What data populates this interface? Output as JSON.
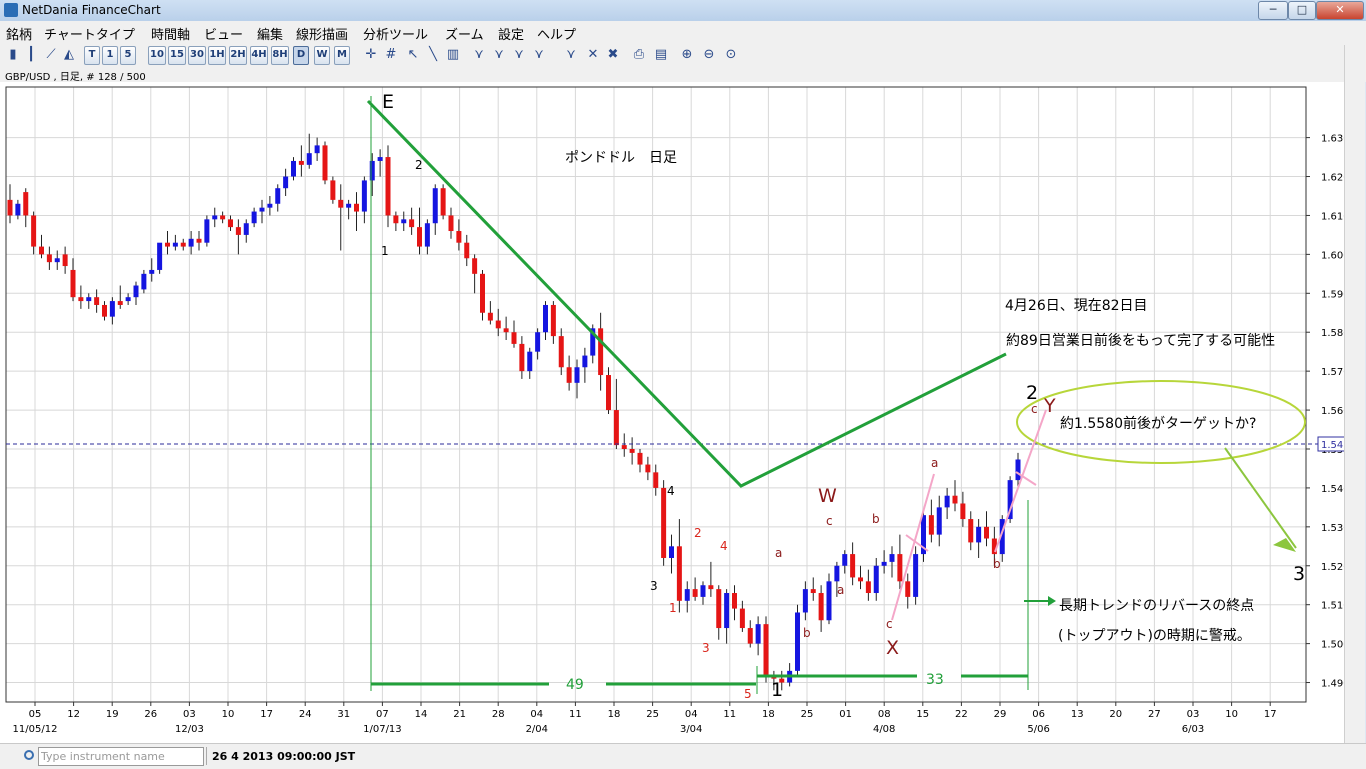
{
  "window": {
    "title": "NetDania FinanceChart",
    "min": "─",
    "max": "□",
    "close": "✕"
  },
  "menu": [
    "銘柄",
    "チャートタイプ",
    "時間軸",
    "ビュー",
    "編集",
    "線形描画",
    "分析ツール",
    "ズーム",
    "設定",
    "ヘルプ"
  ],
  "toolbar": {
    "timeframes": [
      "T",
      "1",
      "5",
      "10",
      "15",
      "30",
      "1H",
      "2H",
      "4H",
      "8H",
      "D",
      "W",
      "M"
    ],
    "selected": "D"
  },
  "info": "GBP/USD , 日足, # 128 / 500",
  "search": {
    "placeholder": "Type instrument name"
  },
  "status": {
    "datetime": "26 4 2013 09:00:00 JST"
  },
  "chart_data": {
    "type": "candlestick",
    "symbol": "GBP/USD",
    "timeframe": "日足",
    "ylim": [
      1.485,
      1.643
    ],
    "y_ticks": [
      "1.6300",
      "1.6200",
      "1.6100",
      "1.6000",
      "1.5900",
      "1.5800",
      "1.5700",
      "1.5600",
      "1.5500",
      "1.5400",
      "1.5300",
      "1.5200",
      "1.5100",
      "1.5000",
      "1.4900"
    ],
    "current_price": "1.5473",
    "x_ticks": [
      "05",
      "12",
      "19",
      "26",
      "03",
      "10",
      "17",
      "24",
      "31",
      "07",
      "14",
      "21",
      "28",
      "04",
      "11",
      "18",
      "25",
      "04",
      "11",
      "18",
      "25",
      "01",
      "08",
      "15",
      "22",
      "29",
      "06",
      "13",
      "20",
      "27",
      "03",
      "10",
      "17"
    ],
    "x_month_labels": [
      "11/05/12",
      "12/03",
      "1/07/13",
      "2/04",
      "3/04",
      "4/08",
      "5/06",
      "6/03"
    ],
    "up_color": "#1515e0",
    "down_color": "#e51515",
    "candles": [
      [
        1.614,
        1.618,
        1.608,
        1.61
      ],
      [
        1.61,
        1.614,
        1.609,
        1.613
      ],
      [
        1.616,
        1.617,
        1.607,
        1.61
      ],
      [
        1.61,
        1.611,
        1.6,
        1.602
      ],
      [
        1.602,
        1.605,
        1.599,
        1.6
      ],
      [
        1.6,
        1.602,
        1.596,
        1.598
      ],
      [
        1.598,
        1.601,
        1.596,
        1.599
      ],
      [
        1.6,
        1.602,
        1.595,
        1.597
      ],
      [
        1.596,
        1.599,
        1.588,
        1.589
      ],
      [
        1.589,
        1.592,
        1.586,
        1.588
      ],
      [
        1.588,
        1.59,
        1.586,
        1.589
      ],
      [
        1.589,
        1.591,
        1.585,
        1.587
      ],
      [
        1.587,
        1.588,
        1.583,
        1.584
      ],
      [
        1.584,
        1.589,
        1.582,
        1.588
      ],
      [
        1.588,
        1.592,
        1.586,
        1.587
      ],
      [
        1.588,
        1.59,
        1.587,
        1.589
      ],
      [
        1.589,
        1.593,
        1.587,
        1.592
      ],
      [
        1.591,
        1.596,
        1.59,
        1.595
      ],
      [
        1.595,
        1.599,
        1.593,
        1.596
      ],
      [
        1.596,
        1.602,
        1.595,
        1.603
      ],
      [
        1.603,
        1.606,
        1.6,
        1.602
      ],
      [
        1.602,
        1.605,
        1.601,
        1.603
      ],
      [
        1.603,
        1.604,
        1.601,
        1.602
      ],
      [
        1.602,
        1.606,
        1.6,
        1.604
      ],
      [
        1.604,
        1.606,
        1.601,
        1.603
      ],
      [
        1.603,
        1.61,
        1.602,
        1.609
      ],
      [
        1.609,
        1.612,
        1.607,
        1.61
      ],
      [
        1.61,
        1.611,
        1.608,
        1.609
      ],
      [
        1.609,
        1.61,
        1.606,
        1.607
      ],
      [
        1.607,
        1.609,
        1.6,
        1.605
      ],
      [
        1.605,
        1.609,
        1.603,
        1.608
      ],
      [
        1.608,
        1.612,
        1.607,
        1.611
      ],
      [
        1.611,
        1.614,
        1.608,
        1.612
      ],
      [
        1.612,
        1.615,
        1.61,
        1.613
      ],
      [
        1.613,
        1.618,
        1.611,
        1.617
      ],
      [
        1.617,
        1.622,
        1.615,
        1.62
      ],
      [
        1.62,
        1.625,
        1.619,
        1.624
      ],
      [
        1.624,
        1.628,
        1.62,
        1.623
      ],
      [
        1.623,
        1.631,
        1.622,
        1.626
      ],
      [
        1.626,
        1.63,
        1.624,
        1.628
      ],
      [
        1.628,
        1.629,
        1.618,
        1.619
      ],
      [
        1.619,
        1.62,
        1.613,
        1.614
      ],
      [
        1.614,
        1.618,
        1.601,
        1.612
      ],
      [
        1.612,
        1.614,
        1.609,
        1.613
      ],
      [
        1.613,
        1.616,
        1.606,
        1.611
      ],
      [
        1.611,
        1.62,
        1.608,
        1.619
      ],
      [
        1.619,
        1.626,
        1.615,
        1.624
      ],
      [
        1.624,
        1.627,
        1.62,
        1.625
      ],
      [
        1.625,
        1.628,
        1.607,
        1.61
      ],
      [
        1.61,
        1.611,
        1.606,
        1.608
      ],
      [
        1.608,
        1.611,
        1.606,
        1.609
      ],
      [
        1.609,
        1.612,
        1.605,
        1.607
      ],
      [
        1.607,
        1.612,
        1.6,
        1.602
      ],
      [
        1.602,
        1.609,
        1.6,
        1.608
      ],
      [
        1.608,
        1.618,
        1.605,
        1.617
      ],
      [
        1.617,
        1.618,
        1.609,
        1.61
      ],
      [
        1.61,
        1.612,
        1.604,
        1.606
      ],
      [
        1.606,
        1.609,
        1.601,
        1.603
      ],
      [
        1.603,
        1.605,
        1.597,
        1.599
      ],
      [
        1.599,
        1.6,
        1.59,
        1.595
      ],
      [
        1.595,
        1.596,
        1.583,
        1.585
      ],
      [
        1.585,
        1.588,
        1.582,
        1.583
      ],
      [
        1.583,
        1.586,
        1.579,
        1.581
      ],
      [
        1.581,
        1.584,
        1.578,
        1.58
      ],
      [
        1.58,
        1.583,
        1.576,
        1.577
      ],
      [
        1.577,
        1.579,
        1.568,
        1.57
      ],
      [
        1.57,
        1.576,
        1.568,
        1.575
      ],
      [
        1.575,
        1.581,
        1.573,
        1.58
      ],
      [
        1.58,
        1.588,
        1.578,
        1.587
      ],
      [
        1.587,
        1.588,
        1.577,
        1.579
      ],
      [
        1.579,
        1.581,
        1.569,
        1.571
      ],
      [
        1.571,
        1.574,
        1.565,
        1.567
      ],
      [
        1.567,
        1.573,
        1.563,
        1.571
      ],
      [
        1.571,
        1.576,
        1.567,
        1.574
      ],
      [
        1.574,
        1.582,
        1.572,
        1.581
      ],
      [
        1.581,
        1.585,
        1.565,
        1.569
      ],
      [
        1.569,
        1.571,
        1.559,
        1.56
      ],
      [
        1.56,
        1.568,
        1.55,
        1.551
      ],
      [
        1.551,
        1.554,
        1.548,
        1.55
      ],
      [
        1.55,
        1.553,
        1.546,
        1.549
      ],
      [
        1.549,
        1.55,
        1.544,
        1.546
      ],
      [
        1.546,
        1.548,
        1.542,
        1.544
      ],
      [
        1.544,
        1.546,
        1.538,
        1.54
      ],
      [
        1.54,
        1.542,
        1.52,
        1.522
      ],
      [
        1.522,
        1.528,
        1.518,
        1.525
      ],
      [
        1.525,
        1.532,
        1.508,
        1.511
      ],
      [
        1.511,
        1.516,
        1.508,
        1.514
      ],
      [
        1.514,
        1.517,
        1.511,
        1.512
      ],
      [
        1.512,
        1.516,
        1.51,
        1.515
      ],
      [
        1.515,
        1.521,
        1.512,
        1.514
      ],
      [
        1.514,
        1.515,
        1.501,
        1.504
      ],
      [
        1.504,
        1.514,
        1.5,
        1.513
      ],
      [
        1.513,
        1.515,
        1.506,
        1.509
      ],
      [
        1.509,
        1.511,
        1.503,
        1.504
      ],
      [
        1.504,
        1.506,
        1.499,
        1.5
      ],
      [
        1.5,
        1.507,
        1.497,
        1.505
      ],
      [
        1.505,
        1.507,
        1.49,
        1.492
      ],
      [
        1.492,
        1.493,
        1.488,
        1.491
      ],
      [
        1.491,
        1.493,
        1.488,
        1.49
      ],
      [
        1.49,
        1.495,
        1.489,
        1.493
      ],
      [
        1.493,
        1.51,
        1.492,
        1.508
      ],
      [
        1.508,
        1.516,
        1.506,
        1.514
      ],
      [
        1.514,
        1.517,
        1.511,
        1.513
      ],
      [
        1.513,
        1.515,
        1.503,
        1.506
      ],
      [
        1.506,
        1.518,
        1.505,
        1.516
      ],
      [
        1.516,
        1.521,
        1.512,
        1.52
      ],
      [
        1.52,
        1.524,
        1.518,
        1.523
      ],
      [
        1.523,
        1.526,
        1.515,
        1.517
      ],
      [
        1.517,
        1.52,
        1.514,
        1.516
      ],
      [
        1.516,
        1.519,
        1.511,
        1.513
      ],
      [
        1.513,
        1.522,
        1.511,
        1.52
      ],
      [
        1.52,
        1.524,
        1.518,
        1.521
      ],
      [
        1.521,
        1.525,
        1.517,
        1.523
      ],
      [
        1.523,
        1.528,
        1.514,
        1.516
      ],
      [
        1.516,
        1.518,
        1.509,
        1.512
      ],
      [
        1.512,
        1.525,
        1.51,
        1.523
      ],
      [
        1.523,
        1.534,
        1.521,
        1.533
      ],
      [
        1.533,
        1.537,
        1.526,
        1.528
      ],
      [
        1.528,
        1.538,
        1.525,
        1.535
      ],
      [
        1.535,
        1.54,
        1.532,
        1.538
      ],
      [
        1.538,
        1.542,
        1.534,
        1.536
      ],
      [
        1.536,
        1.539,
        1.53,
        1.532
      ],
      [
        1.532,
        1.534,
        1.524,
        1.526
      ],
      [
        1.526,
        1.532,
        1.522,
        1.53
      ],
      [
        1.53,
        1.534,
        1.525,
        1.527
      ],
      [
        1.527,
        1.53,
        1.52,
        1.523
      ],
      [
        1.523,
        1.533,
        1.521,
        1.532
      ],
      [
        1.532,
        1.543,
        1.531,
        1.542
      ],
      [
        1.542,
        1.549,
        1.54,
        1.5473
      ]
    ],
    "labels": {
      "title": "ポンドドル　日足",
      "note1": "4月26日、現在82日目",
      "note2": "約89日営業日前後をもって完了する可能性",
      "target": "約1.5580前後がターゲットか?",
      "warn1": "長期トレンドのリバースの終点",
      "warn2": "(トップアウト)の時期に警戒。",
      "count49": "49",
      "count33": "33",
      "E": "E",
      "w1_big": "1",
      "w2_big": "2",
      "w3_big": "3",
      "W": "W",
      "X": "X",
      "Y": "Y",
      "sub1": "1",
      "sub2": "2",
      "sub3": "3",
      "sub4": "4",
      "r1": "1",
      "r2": "2",
      "r3": "3",
      "r4": "4",
      "r5": "5",
      "a1": "a",
      "b1": "b",
      "c1": "c",
      "a2": "a",
      "b2": "b",
      "c2": "c",
      "a3": "a",
      "b3": "b",
      "c3": "c",
      "b4": "b",
      "c4": "c"
    }
  }
}
